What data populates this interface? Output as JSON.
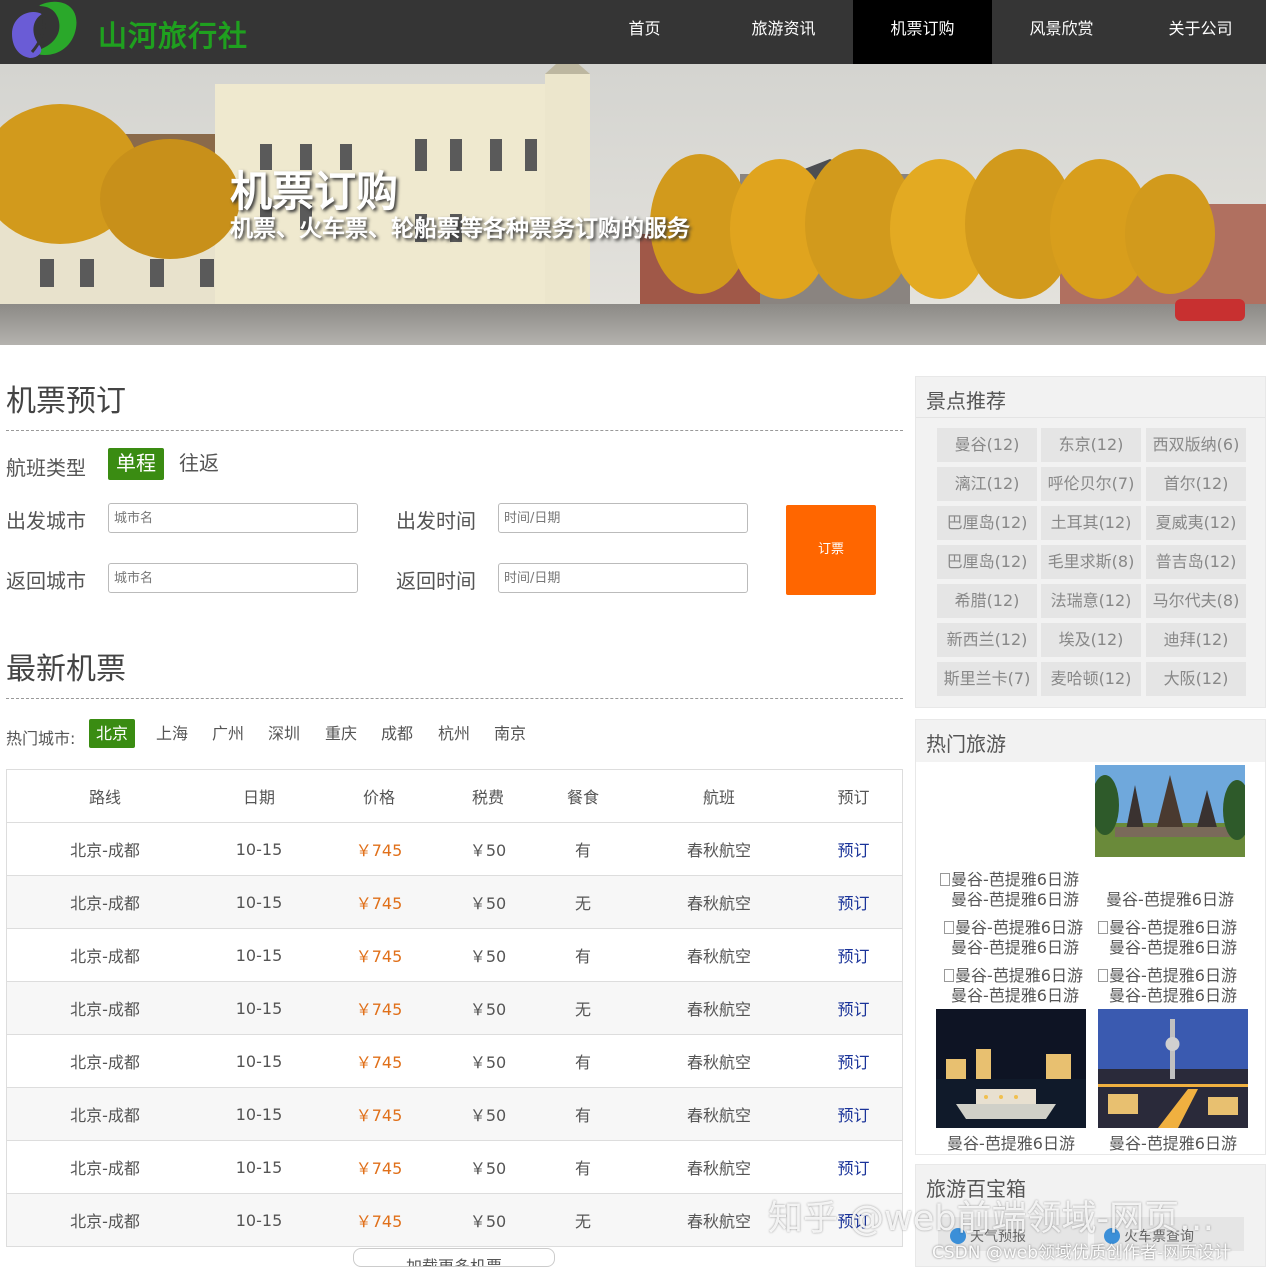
{
  "brand": {
    "name": "山河旅行社",
    "logo": "leaf-logo",
    "accent": "#1fa01f"
  },
  "nav": [
    {
      "label": "首页",
      "active": false
    },
    {
      "label": "旅游资讯",
      "active": false
    },
    {
      "label": "机票订购",
      "active": true
    },
    {
      "label": "风景欣赏",
      "active": false
    },
    {
      "label": "关于公司",
      "active": false
    }
  ],
  "banner": {
    "title": "机票订购",
    "subtitle": "机票、火车票、轮船票等各种票务订购的服务"
  },
  "booking": {
    "title": "机票预订",
    "flight_type_label": "航班类型",
    "one_way": "单程",
    "round_trip": "往返",
    "depart_city_label": "出发城市",
    "depart_city_placeholder": "城市名",
    "depart_time_label": "出发时间",
    "depart_time_placeholder": "时间/日期",
    "return_city_label": "返回城市",
    "return_city_placeholder": "城市名",
    "return_time_label": "返回时间",
    "return_time_placeholder": "时间/日期",
    "submit": "订票",
    "submit_color": "#ff6600"
  },
  "latest": {
    "title": "最新机票",
    "hot_label": "热门城市:",
    "cities": [
      "北京",
      "上海",
      "广州",
      "深圳",
      "重庆",
      "成都",
      "杭州",
      "南京"
    ],
    "active_city": "北京",
    "headers": [
      "路线",
      "日期",
      "价格",
      "税费",
      "餐食",
      "航班",
      "预订"
    ],
    "rows": [
      [
        "北京-成都",
        "10-15",
        "￥745",
        "￥50",
        "有",
        "春秋航空",
        "预订"
      ],
      [
        "北京-成都",
        "10-15",
        "￥745",
        "￥50",
        "无",
        "春秋航空",
        "预订"
      ],
      [
        "北京-成都",
        "10-15",
        "￥745",
        "￥50",
        "有",
        "春秋航空",
        "预订"
      ],
      [
        "北京-成都",
        "10-15",
        "￥745",
        "￥50",
        "无",
        "春秋航空",
        "预订"
      ],
      [
        "北京-成都",
        "10-15",
        "￥745",
        "￥50",
        "有",
        "春秋航空",
        "预订"
      ],
      [
        "北京-成都",
        "10-15",
        "￥745",
        "￥50",
        "有",
        "春秋航空",
        "预订"
      ],
      [
        "北京-成都",
        "10-15",
        "￥745",
        "￥50",
        "有",
        "春秋航空",
        "预订"
      ],
      [
        "北京-成都",
        "10-15",
        "￥745",
        "￥50",
        "无",
        "春秋航空",
        "预订"
      ]
    ],
    "more_label": "加载更多机票"
  },
  "spots": {
    "title": "景点推荐",
    "tags": [
      "曼谷(12)",
      "东京(12)",
      "西双版纳(6)",
      "漓江(12)",
      "呼伦贝尔(7)",
      "首尔(12)",
      "巴厘岛(12)",
      "土耳其(12)",
      "夏威夷(12)",
      "巴厘岛(12)",
      "毛里求斯(8)",
      "普吉岛(12)",
      "希腊(12)",
      "法瑞意(12)",
      "马尔代夫(8)",
      "新西兰(12)",
      "埃及(12)",
      "迪拜(12)",
      "斯里兰卡(7)",
      "麦哈顿(12)",
      "大阪(12)"
    ]
  },
  "tours": {
    "title": "热门旅游",
    "item_label": "曼谷-芭提雅6日游",
    "img_alt": "曼谷-芭提雅6日游"
  },
  "toolbox": {
    "title": "旅游百宝箱",
    "items": [
      "天气预报",
      "火车票查询"
    ]
  },
  "watermarks": {
    "zhihu": "知乎 @web前端领域-网页…",
    "csdn": "CSDN @web领域优质创作者-网页设计"
  }
}
